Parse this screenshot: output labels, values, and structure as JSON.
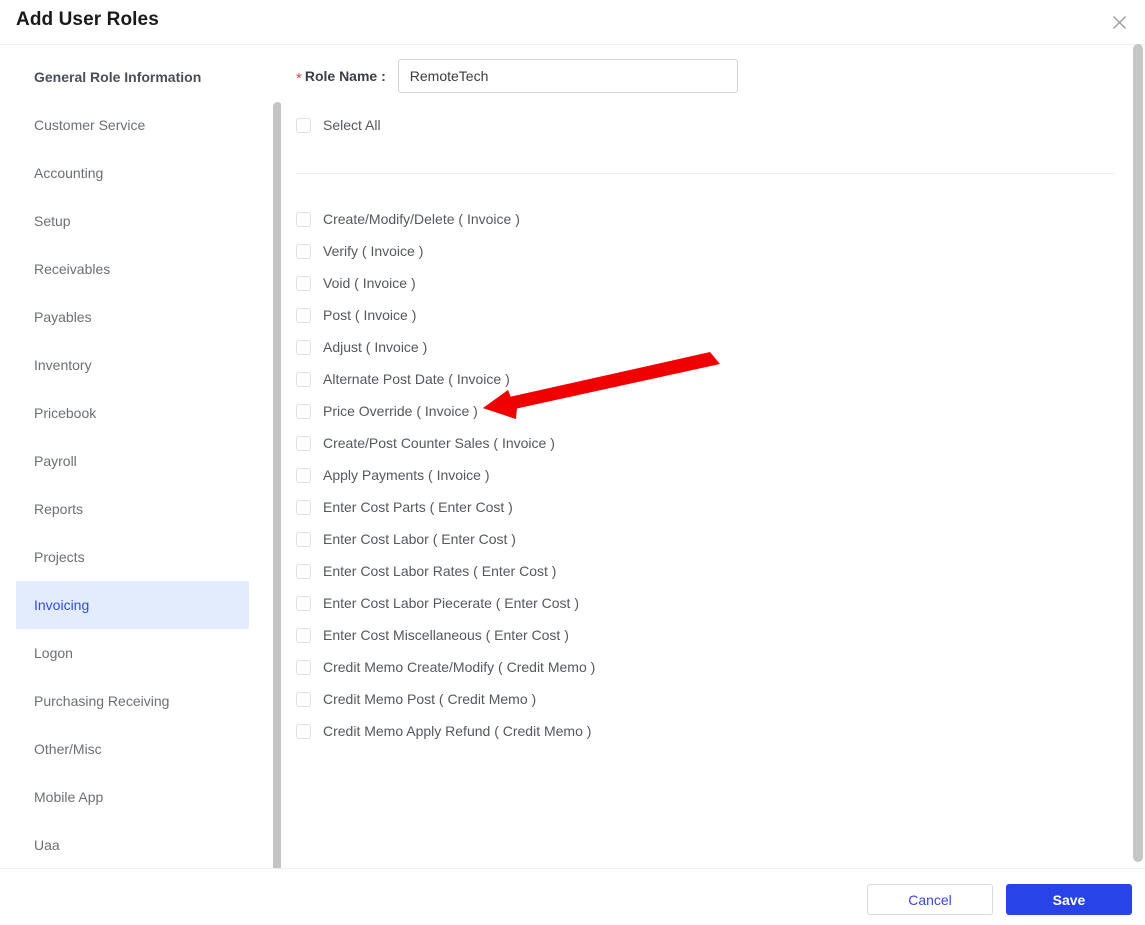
{
  "header": {
    "title": "Add User Roles",
    "close_icon": "close-icon"
  },
  "sidebar": {
    "items": [
      {
        "label": "General Role Information",
        "active": false,
        "heading": true
      },
      {
        "label": "Customer Service",
        "active": false
      },
      {
        "label": "Accounting",
        "active": false
      },
      {
        "label": "Setup",
        "active": false
      },
      {
        "label": "Receivables",
        "active": false
      },
      {
        "label": "Payables",
        "active": false
      },
      {
        "label": "Inventory",
        "active": false
      },
      {
        "label": "Pricebook",
        "active": false
      },
      {
        "label": "Payroll",
        "active": false
      },
      {
        "label": "Reports",
        "active": false
      },
      {
        "label": "Projects",
        "active": false
      },
      {
        "label": "Invoicing",
        "active": true
      },
      {
        "label": "Logon",
        "active": false
      },
      {
        "label": "Purchasing Receiving",
        "active": false
      },
      {
        "label": "Other/Misc",
        "active": false
      },
      {
        "label": "Mobile App",
        "active": false
      },
      {
        "label": "Uaa",
        "active": false
      }
    ]
  },
  "form": {
    "required_marker": "*",
    "role_name_label": "Role Name :",
    "role_name_value": "RemoteTech",
    "role_name_placeholder": "",
    "select_all_label": "Select All",
    "select_all_checked": false
  },
  "permissions": [
    {
      "label": "Create/Modify/Delete ( Invoice )",
      "checked": false
    },
    {
      "label": "Verify ( Invoice )",
      "checked": false
    },
    {
      "label": "Void ( Invoice )",
      "checked": false
    },
    {
      "label": "Post ( Invoice )",
      "checked": false
    },
    {
      "label": "Adjust ( Invoice )",
      "checked": false
    },
    {
      "label": "Alternate Post Date ( Invoice )",
      "checked": false
    },
    {
      "label": "Price Override ( Invoice )",
      "checked": false
    },
    {
      "label": "Create/Post Counter Sales ( Invoice )",
      "checked": false
    },
    {
      "label": "Apply Payments ( Invoice )",
      "checked": false
    },
    {
      "label": "Enter Cost Parts ( Enter Cost )",
      "checked": false
    },
    {
      "label": "Enter Cost Labor ( Enter Cost )",
      "checked": false
    },
    {
      "label": "Enter Cost Labor Rates ( Enter Cost )",
      "checked": false
    },
    {
      "label": "Enter Cost Labor Piecerate ( Enter Cost )",
      "checked": false
    },
    {
      "label": "Enter Cost Miscellaneous ( Enter Cost )",
      "checked": false
    },
    {
      "label": "Credit Memo Create/Modify ( Credit Memo )",
      "checked": false
    },
    {
      "label": "Credit Memo Post ( Credit Memo )",
      "checked": false
    },
    {
      "label": "Credit Memo Apply Refund ( Credit Memo )",
      "checked": false
    }
  ],
  "footer": {
    "cancel_label": "Cancel",
    "save_label": "Save"
  },
  "colors": {
    "accent_blue": "#2843e8",
    "active_nav_bg": "#e3ecfd",
    "active_nav_text": "#2d4bf5",
    "required_red": "#e8414f",
    "annotation_red": "#f00000"
  },
  "annotation": {
    "type": "arrow",
    "points_to": "Price Override ( Invoice )",
    "color": "#f00000"
  }
}
